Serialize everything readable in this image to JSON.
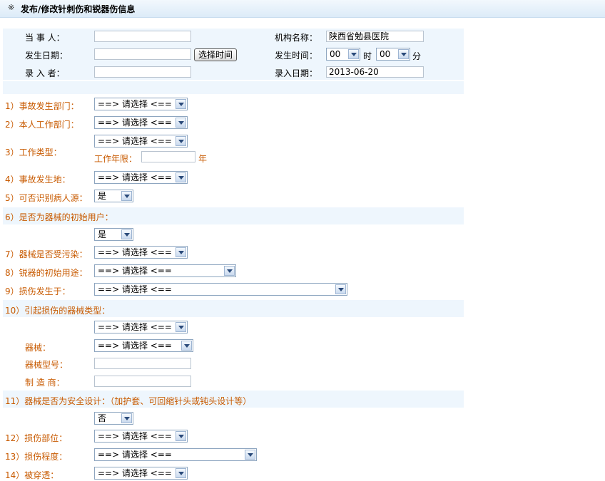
{
  "header": {
    "icon": "double-arrow-icon",
    "title": "发布/修改针刺伤和锐器伤信息"
  },
  "top": {
    "party_label": "当 事 人：",
    "party_value": "",
    "date_label": "发生日期：",
    "date_value": "",
    "choose_time": "选择时间",
    "entry_person_label": "录 入 者：",
    "entry_person_value": "",
    "org_label": "机构名称：",
    "org_value": "陕西省勉县医院",
    "time_label": "发生时间：",
    "hour_value": "00",
    "hour_unit": "时",
    "minute_value": "00",
    "minute_unit": "分",
    "entry_date_label": "录入日期：",
    "entry_date_value": "2013-06-20"
  },
  "q": {
    "q1": "1）事故发生部门：",
    "q2": "2）本人工作部门：",
    "q3": "3）工作类型：",
    "q3_years_label": "工作年限：",
    "q3_years_unit": "年",
    "q4": "4）事故发生地：",
    "q5": "5）可否识别病人源：",
    "q6": "6）是否为器械的初始用户：",
    "q7": "7）器械是否受污染：",
    "q8": "8）锐器的初始用途：",
    "q9": "9）损伤发生于：",
    "q10": "10）引起损伤的器械类型：",
    "q10_device_label": "器械：",
    "q10_model_label": "器械型号：",
    "q10_maker_label": "制 造 商：",
    "q11": "11）器械是否为安全设计：（加护套、可回缩针头或钝头设计等）",
    "q12": "12）损伤部位：",
    "q13": "13）损伤程度：",
    "q14": "14）被穿透："
  },
  "sel": {
    "choose": "==> 请选择 <==",
    "yes": "是",
    "no": "否"
  }
}
